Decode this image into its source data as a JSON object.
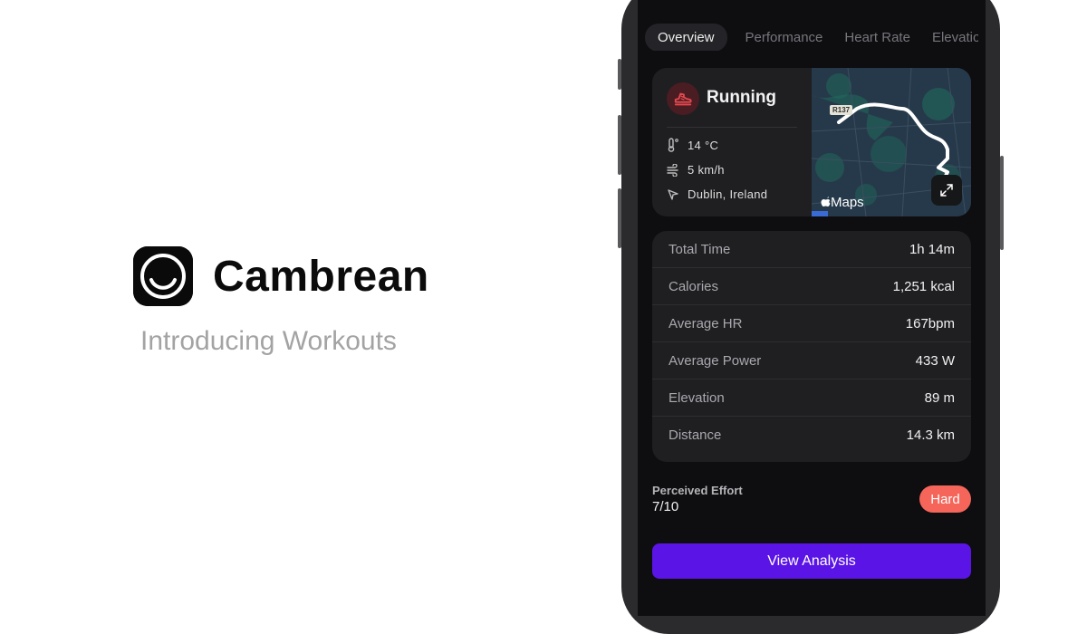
{
  "brand": {
    "name": "Cambrean",
    "tagline": "Introducing Workouts"
  },
  "tabs": [
    {
      "label": "Overview",
      "active": true
    },
    {
      "label": "Performance",
      "active": false
    },
    {
      "label": "Heart Rate",
      "active": false
    },
    {
      "label": "Elevation",
      "active": false
    }
  ],
  "activity": {
    "title": "Running",
    "icon": "running-shoe-icon",
    "temperature": "14 °C",
    "wind": "5 km/h",
    "location": "Dublin, Ireland"
  },
  "map": {
    "attribution": "Maps",
    "road_sign": "R137"
  },
  "stats": [
    {
      "label": "Total Time",
      "value": "1h 14m"
    },
    {
      "label": "Calories",
      "value": "1,251 kcal"
    },
    {
      "label": "Average HR",
      "value": "167bpm"
    },
    {
      "label": "Average Power",
      "value": "433 W"
    },
    {
      "label": "Elevation",
      "value": "89 m"
    },
    {
      "label": "Distance",
      "value": "14.3 km"
    }
  ],
  "effort": {
    "title": "Perceived Effort",
    "value": "7/10",
    "badge": "Hard"
  },
  "cta": "View Analysis",
  "colors": {
    "accent": "#5b14e6",
    "badge": "#f5655a",
    "activity_icon": "#e6484e",
    "card": "#1f1f22",
    "screen": "#0e0d10"
  }
}
